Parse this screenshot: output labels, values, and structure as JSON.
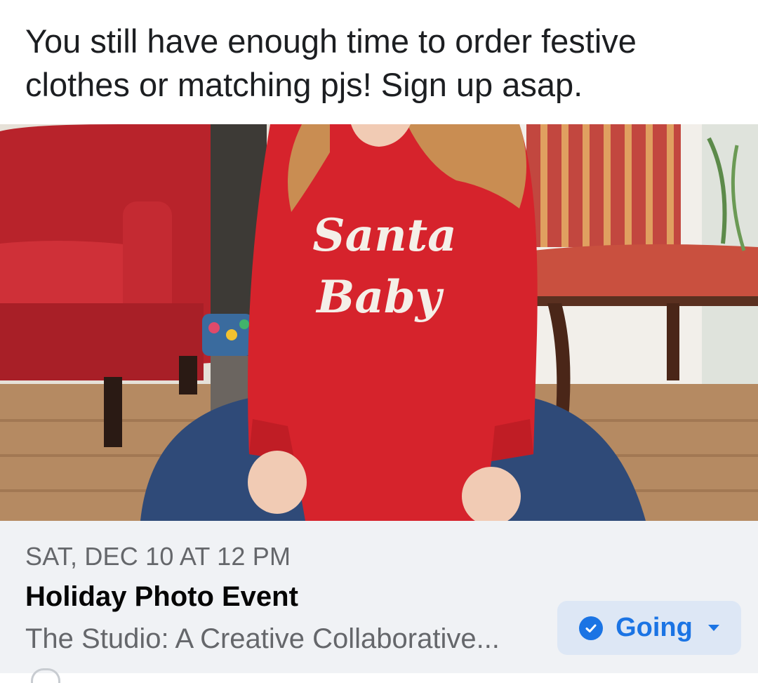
{
  "post": {
    "text": "You still have enough time to order festive\nclothes or matching pjs!  Sign up asap."
  },
  "photo": {
    "shirt_text_line1": "Santa",
    "shirt_text_line2": "Baby"
  },
  "event": {
    "date": "SAT, DEC 10 AT 12 PM",
    "title": "Holiday Photo Event",
    "location": "The Studio: A Creative Collaborative..."
  },
  "rsvp": {
    "label": "Going",
    "icon": "check-circle-icon",
    "caret_icon": "caret-down-icon",
    "accent": "#1b74e4"
  }
}
